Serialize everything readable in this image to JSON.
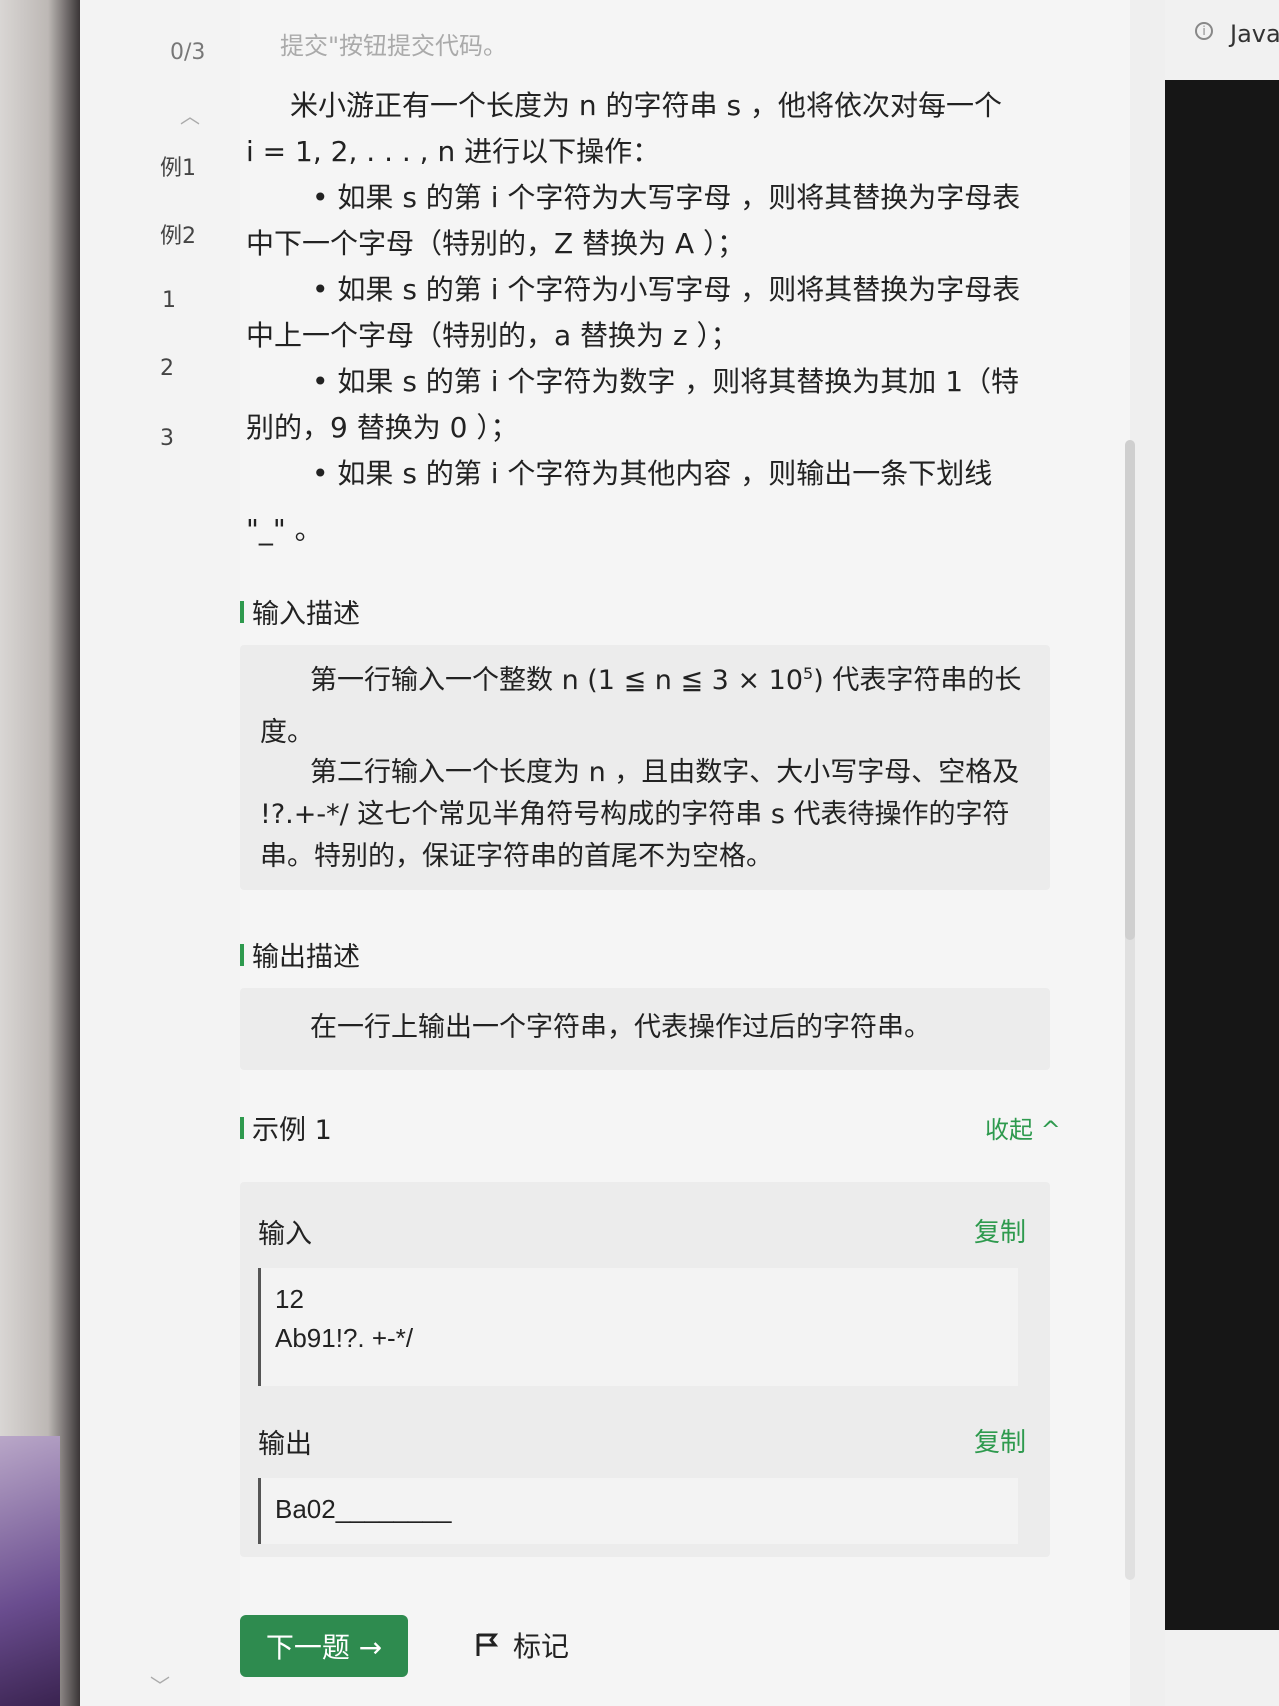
{
  "nav": {
    "counter": "0/3",
    "collapse_glyph": "»",
    "items": [
      "例1",
      "例2",
      "1",
      "2",
      "3"
    ]
  },
  "top_hint": "提交\"按钮提交代码。",
  "statement": {
    "intro_1": "米小游正有一个长度为 n 的字符串 s ，他将依次对每一个",
    "intro_2": "i = 1, 2, . . . , n 进行以下操作：",
    "rule_1a": "• 如果 s 的第 i 个字符为大写字母 ，则将其替换为字母表",
    "rule_1b": "中下一个字母（特别的，Z 替换为 A ）；",
    "rule_2a": "• 如果 s 的第 i 个字符为小写字母 ，则将其替换为字母表",
    "rule_2b": "中上一个字母（特别的，a 替换为 z ）；",
    "rule_3a": "• 如果 s 的第 i 个字符为数字 ，则将其替换为其加 1（特",
    "rule_3b": "别的，9 替换为 0 ）；",
    "rule_4a": "• 如果 s 的第 i 个字符为其他内容 ，则输出一条下划线",
    "rule_4b": "\"_\" 。"
  },
  "input_section": {
    "title": "输入描述",
    "line1_prefix": "第一行输入一个整数 n (1 ≦ n ≦ 3 × 10",
    "line1_sup": "5",
    "line1_suffix": ") 代表字符串的长",
    "line1_cont": "度。",
    "line2": "第二行输入一个长度为 n ，且由数字、大小写字母、空格及",
    "line3": "!?.+-*/ 这七个常见半角符号构成的字符串 s 代表待操作的字符",
    "line4": "串。特别的，保证字符串的首尾不为空格。"
  },
  "output_section": {
    "title": "输出描述",
    "text": "在一行上输出一个字符串，代表操作过后的字符串。"
  },
  "example": {
    "title": "示例 1",
    "collapse_label": "收起 ^",
    "input_label": "输入",
    "output_label": "输出",
    "copy_label": "复制",
    "input_lines": [
      "12",
      "Ab91!?. +-*/"
    ],
    "output_line": "Ba02________"
  },
  "footer": {
    "next_label": "下一题 →",
    "mark_label": "标记"
  },
  "right": {
    "lang": "Java"
  },
  "colors": {
    "accent": "#2e9a4e",
    "next_button": "#2e8b4f"
  }
}
